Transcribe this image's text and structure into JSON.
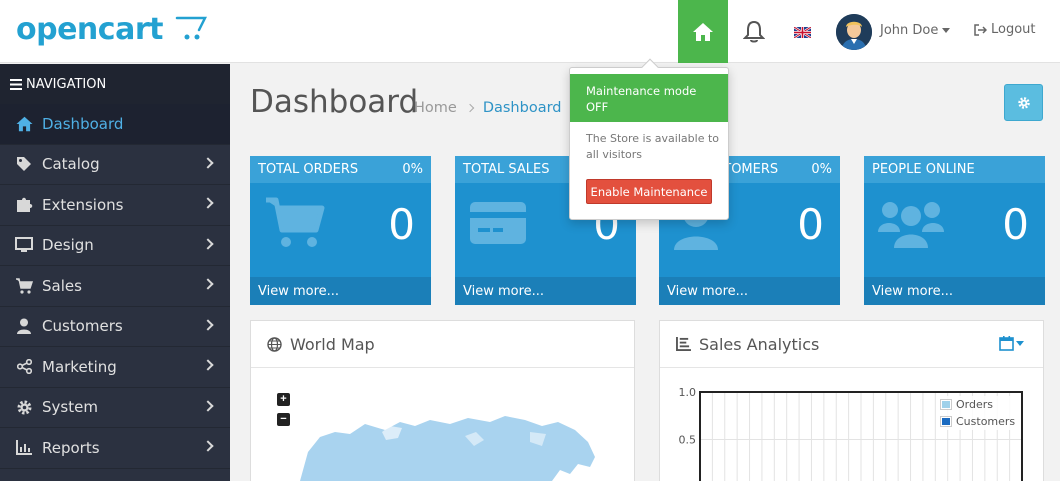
{
  "header": {
    "logo_text": "opencart",
    "user_name": "John Doe",
    "logout_label": "Logout",
    "icons": {
      "home": "home-icon",
      "bell": "bell-icon",
      "flag": "uk-flag-icon",
      "logout": "sign-out-icon"
    },
    "colors": {
      "home_bg": "#4cb64c",
      "logo": "#23a1d1"
    }
  },
  "sidebar": {
    "header_label": "NAVIGATION",
    "items": [
      {
        "label": "Dashboard",
        "icon": "home-icon",
        "active": true
      },
      {
        "label": "Catalog",
        "icon": "tag-icon"
      },
      {
        "label": "Extensions",
        "icon": "puzzle-icon"
      },
      {
        "label": "Design",
        "icon": "monitor-icon"
      },
      {
        "label": "Sales",
        "icon": "cart-icon"
      },
      {
        "label": "Customers",
        "icon": "user-icon"
      },
      {
        "label": "Marketing",
        "icon": "share-icon"
      },
      {
        "label": "System",
        "icon": "cog-icon"
      },
      {
        "label": "Reports",
        "icon": "chart-icon"
      }
    ]
  },
  "main": {
    "title": "Dashboard",
    "breadcrumb": {
      "home": "Home",
      "current": "Dashboard"
    }
  },
  "tiles": [
    {
      "title": "TOTAL ORDERS",
      "percent": "0%",
      "value": "0",
      "link": "View more...",
      "icon": "cart-icon"
    },
    {
      "title": "TOTAL SALES",
      "percent": "",
      "value": "0",
      "link": "View more...",
      "icon": "credit-card-icon"
    },
    {
      "title": "STOMERS",
      "percent": "0%",
      "value": "0",
      "link": "View more...",
      "icon": "user-icon"
    },
    {
      "title": "PEOPLE ONLINE",
      "percent": "",
      "value": "0",
      "link": "View more...",
      "icon": "users-icon"
    }
  ],
  "maintenance_dropdown": {
    "title": "Maintenance mode",
    "status": "OFF",
    "description": "The Store is available to all visitors",
    "button_label": "Enable Maintenance"
  },
  "panels": {
    "world_map": {
      "title": "World Map",
      "zoom_in": "+",
      "zoom_out": "−"
    },
    "sales_analytics": {
      "title": "Sales Analytics"
    }
  },
  "chart_data": {
    "type": "bar",
    "categories": [],
    "series": [
      {
        "name": "Orders",
        "values": []
      },
      {
        "name": "Customers",
        "values": []
      }
    ],
    "yticks": [
      "1.0",
      "0.5"
    ],
    "ylim": [
      0,
      1
    ],
    "grid": true,
    "legend": "top-right",
    "colors": {
      "Orders": "#9fd1ea",
      "Customers": "#1b6bc1"
    }
  }
}
